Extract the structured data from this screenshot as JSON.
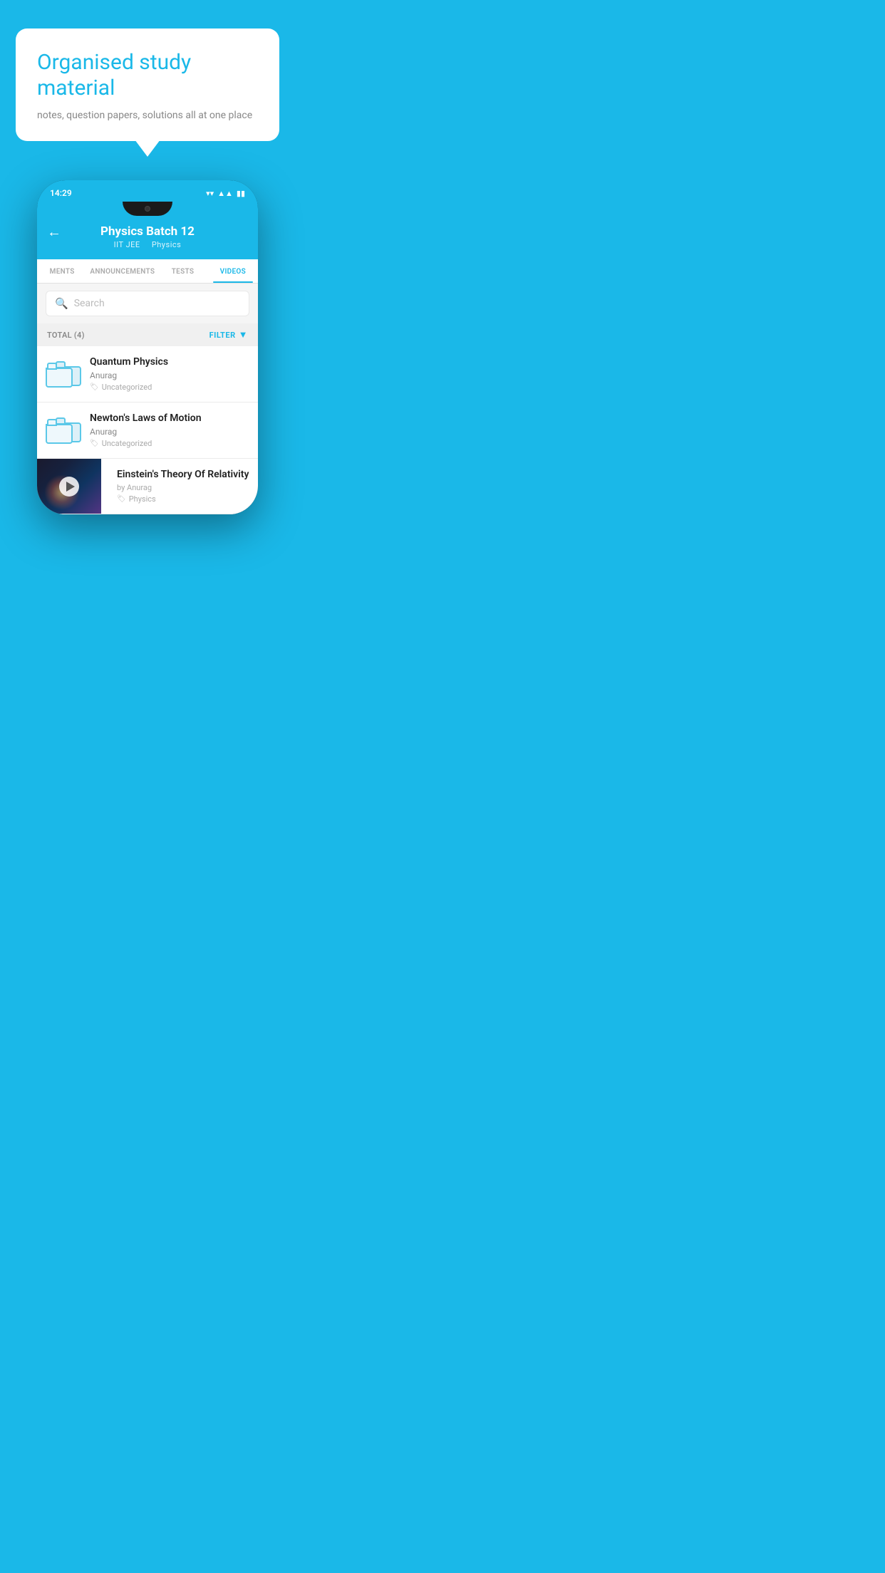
{
  "promo": {
    "title": "Organised study material",
    "subtitle": "notes, question papers, solutions all at one place"
  },
  "status_bar": {
    "time": "14:29",
    "wifi": "▼",
    "signal": "◀",
    "battery": "▮"
  },
  "header": {
    "title": "Physics Batch 12",
    "subtitle_left": "IIT JEE",
    "subtitle_sep": "   ",
    "subtitle_right": "Physics",
    "back_label": "←"
  },
  "tabs": [
    {
      "label": "MENTS",
      "active": false
    },
    {
      "label": "ANNOUNCEMENTS",
      "active": false
    },
    {
      "label": "TESTS",
      "active": false
    },
    {
      "label": "VIDEOS",
      "active": true
    }
  ],
  "search": {
    "placeholder": "Search"
  },
  "filter": {
    "total_label": "TOTAL (4)",
    "filter_label": "FILTER"
  },
  "videos": [
    {
      "id": 1,
      "title": "Quantum Physics",
      "author": "Anurag",
      "tag": "Uncategorized",
      "has_thumb": false
    },
    {
      "id": 2,
      "title": "Newton's Laws of Motion",
      "author": "Anurag",
      "tag": "Uncategorized",
      "has_thumb": false
    },
    {
      "id": 3,
      "title": "Einstein's Theory Of Relativity",
      "author": "by Anurag",
      "tag": "Physics",
      "has_thumb": true
    }
  ]
}
